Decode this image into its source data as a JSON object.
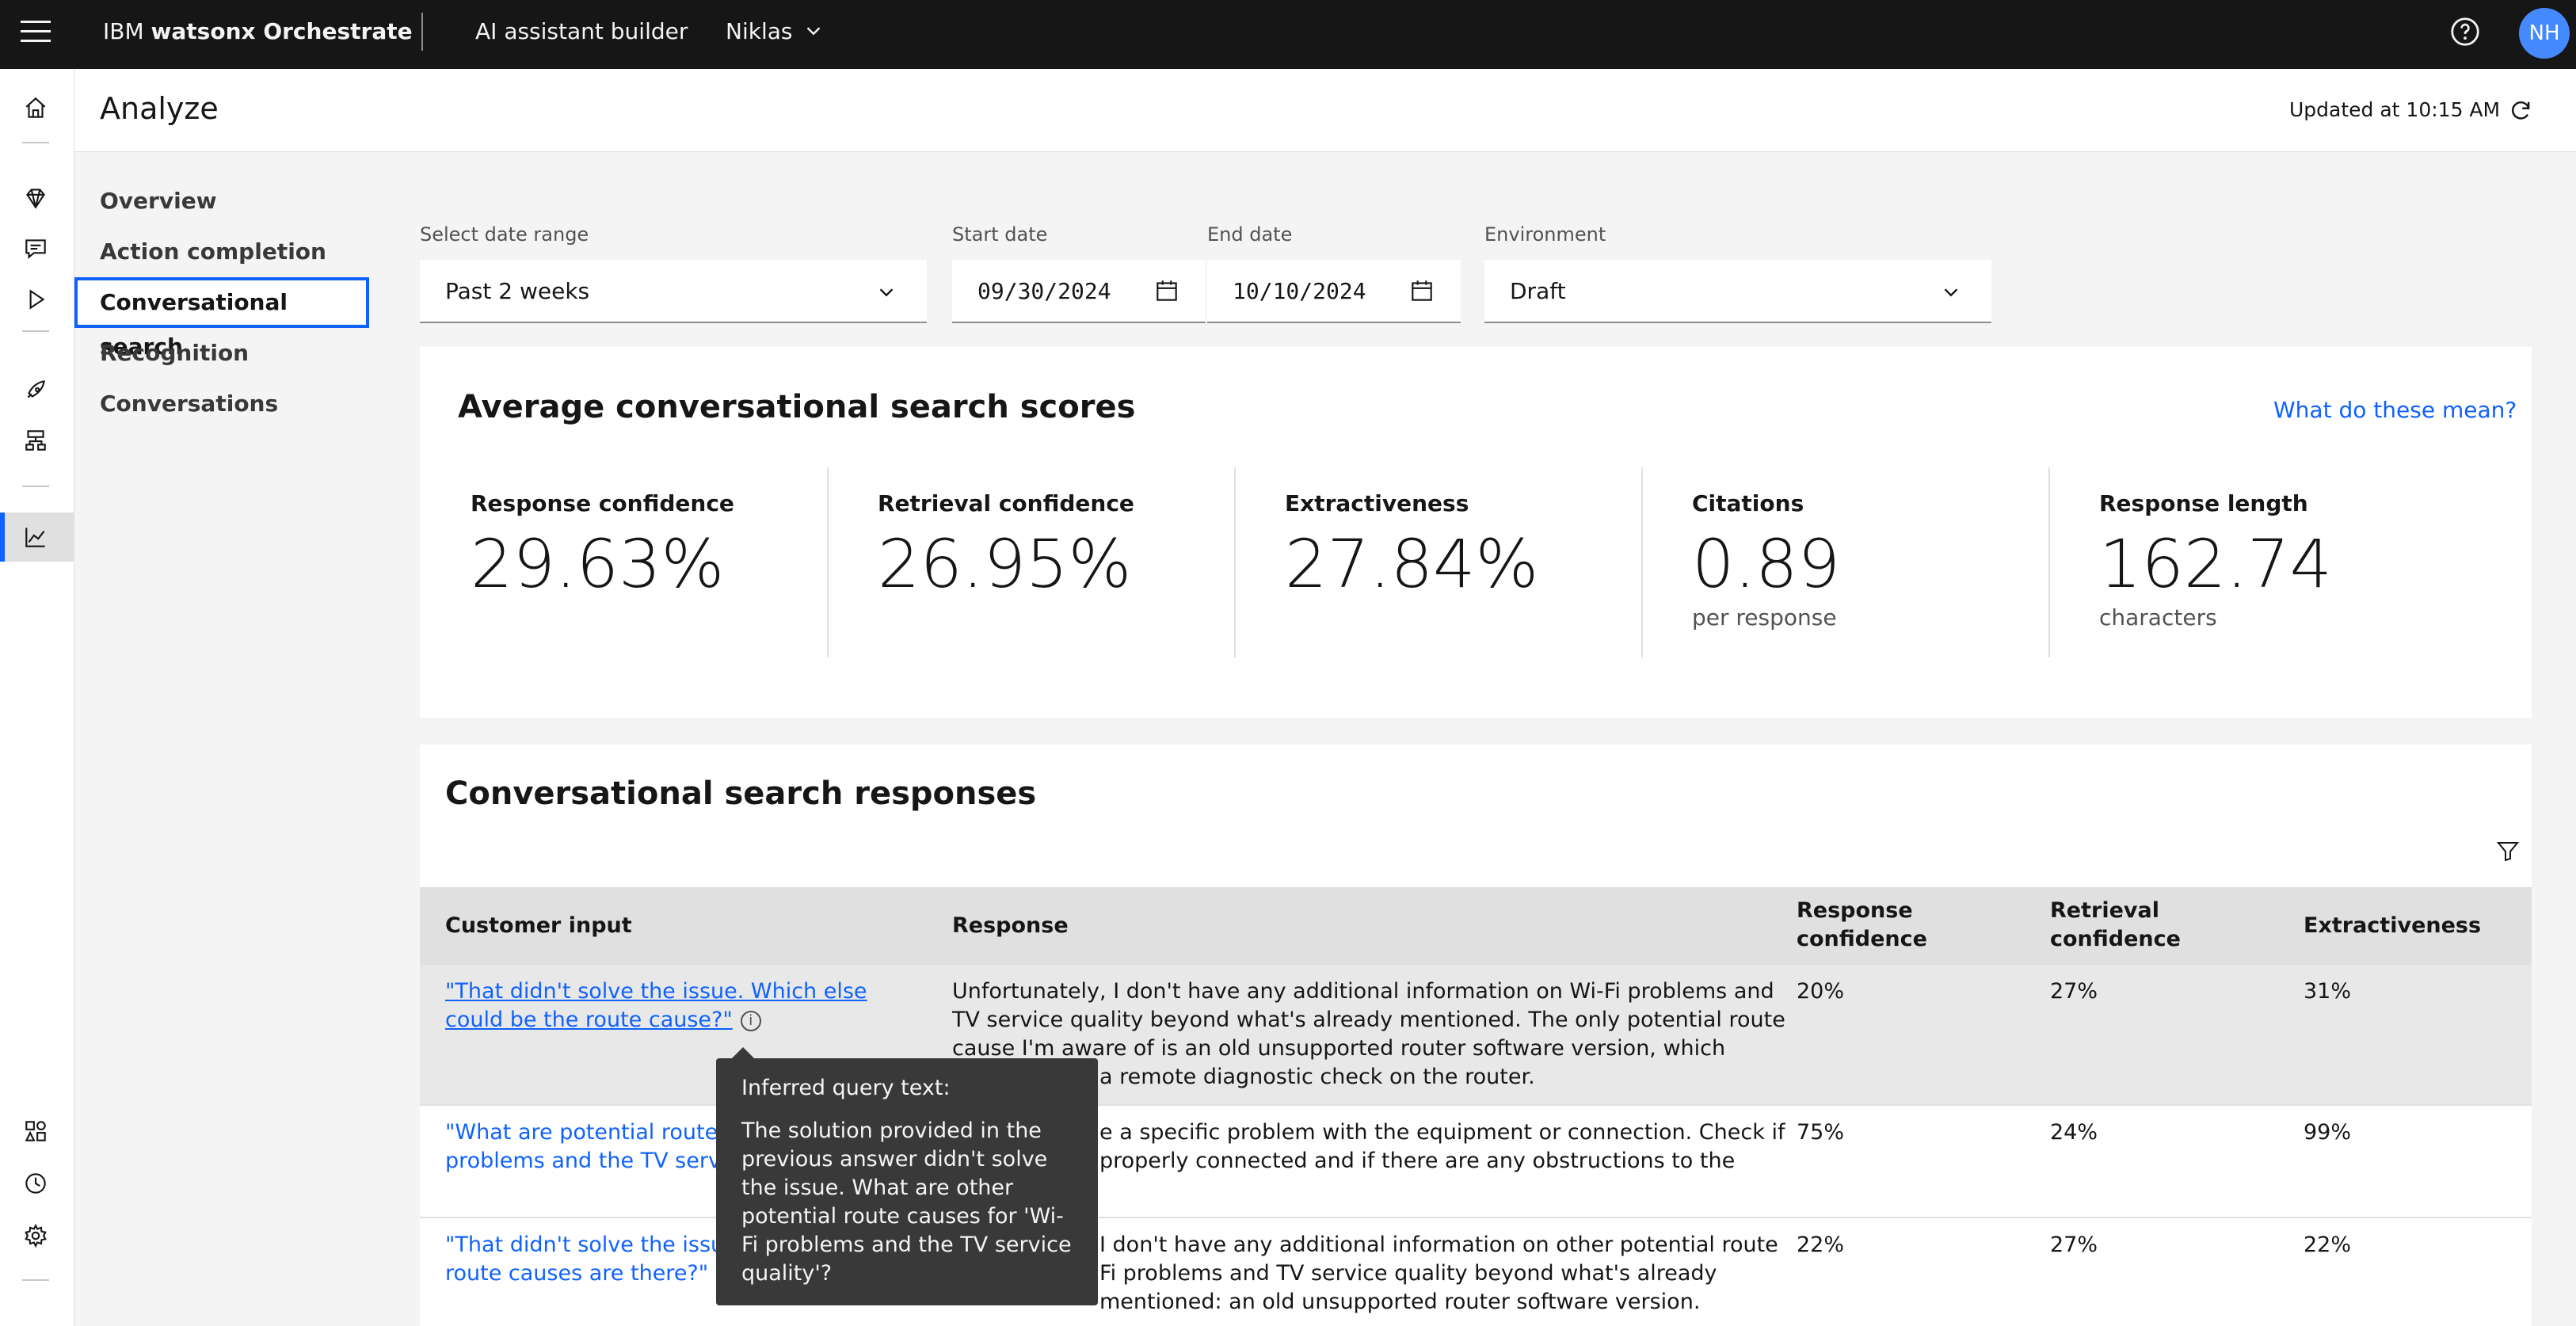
{
  "topbar": {
    "brand_prefix": "IBM",
    "brand_name": "watsonx Orchestrate",
    "builder": "AI assistant builder",
    "instance": "Niklas",
    "avatar_initials": "NH"
  },
  "header": {
    "title": "Analyze",
    "updated": "Updated at 10:15 AM"
  },
  "subnav": {
    "items": [
      "Overview",
      "Action completion",
      "Conversational search",
      "Recognition",
      "Conversations"
    ],
    "active": "Conversational search"
  },
  "filters": {
    "date_range_label": "Select date range",
    "date_range_value": "Past 2 weeks",
    "start_label": "Start date",
    "start_value": "09/30/2024",
    "end_label": "End date",
    "end_value": "10/10/2024",
    "env_label": "Environment",
    "env_value": "Draft"
  },
  "scores": {
    "title": "Average conversational search scores",
    "link": "What do these mean?",
    "tiles": [
      {
        "label": "Response confidence",
        "value": "29.63%",
        "sub": ""
      },
      {
        "label": "Retrieval confidence",
        "value": "26.95%",
        "sub": ""
      },
      {
        "label": "Extractiveness",
        "value": "27.84%",
        "sub": ""
      },
      {
        "label": "Citations",
        "value": "0.89",
        "sub": "per response"
      },
      {
        "label": "Response length",
        "value": "162.74",
        "sub": "characters"
      }
    ]
  },
  "responses": {
    "title": "Conversational search responses",
    "headers": {
      "input": "Customer input",
      "response": "Response",
      "resp_conf_1": "Response",
      "resp_conf_2": "confidence",
      "retr_conf_1": "Retrieval",
      "retr_conf_2": "confidence",
      "extract": "Extractiveness"
    },
    "rows": [
      {
        "input_1": "\"That didn't solve the issue. Which else",
        "input_2": "could be the route cause?\"",
        "resp_1": "Unfortunately, I don't have any additional information on Wi-Fi problems and",
        "resp_2": "TV service quality beyond what's already mentioned. The only potential route",
        "resp_3": "cause I'm aware of is an old unsupported router software version, which",
        "resp_4": "a remote diagnostic check on the router.",
        "resp_conf": "20%",
        "retr_conf": "27%",
        "extract": "31%"
      },
      {
        "input_1": "\"What are potential route c",
        "input_2": "problems and the TV servic",
        "resp_1": "e a specific problem with the equipment or connection. Check if",
        "resp_2": "properly connected and if there are any obstructions to the",
        "resp_conf": "75%",
        "retr_conf": "24%",
        "extract": "99%"
      },
      {
        "input_1": "\"That didn't solve the issue",
        "input_2": "route causes are there?\"",
        "resp_1": "I don't have any additional information on other potential route",
        "resp_2": "Fi problems and TV service quality beyond what's already",
        "resp_3": "mentioned: an old unsupported router software version.",
        "resp_conf": "22%",
        "retr_conf": "27%",
        "extract": "22%"
      }
    ]
  },
  "tooltip": {
    "title": "Inferred query text:",
    "body": "The solution provided in the previous answer didn't solve the issue. What are other potential route causes for 'Wi-Fi problems and the TV service quality'?"
  }
}
